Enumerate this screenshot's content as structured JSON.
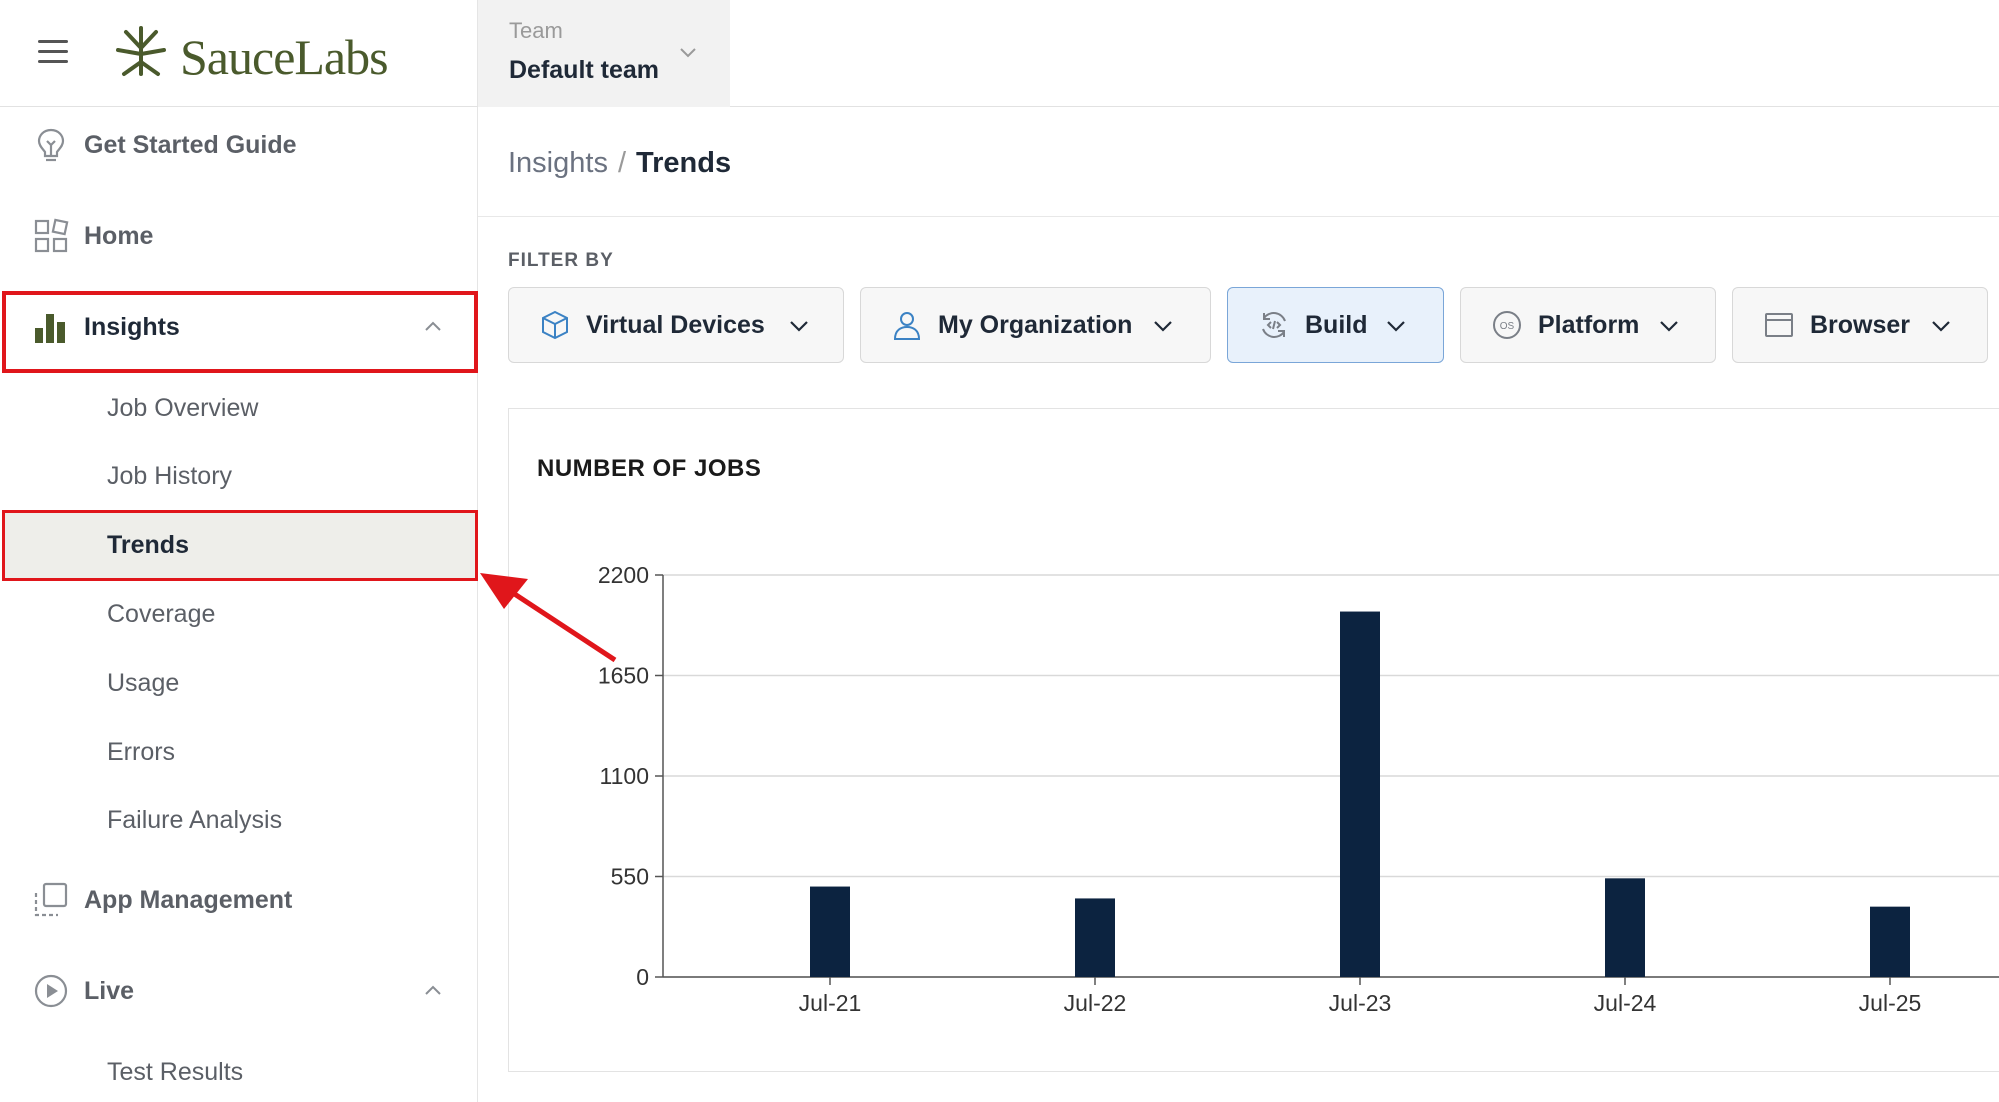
{
  "brand": {
    "name": "SauceLabs"
  },
  "team": {
    "label": "Team",
    "value": "Default team"
  },
  "sidebar": {
    "items": [
      {
        "label": "Get Started Guide",
        "icon": "lightbulb-icon"
      },
      {
        "label": "Home",
        "icon": "grid-icon"
      },
      {
        "label": "Insights",
        "icon": "bar-chart-icon",
        "expanded": true
      },
      {
        "label": "App Management",
        "icon": "app-icon"
      },
      {
        "label": "Live",
        "icon": "play-icon",
        "expanded": true
      }
    ],
    "insights_sub": [
      "Job Overview",
      "Job History",
      "Trends",
      "Coverage",
      "Usage",
      "Errors",
      "Failure Analysis"
    ],
    "live_sub": [
      "Test Results"
    ]
  },
  "breadcrumb": {
    "parent": "Insights",
    "separator": "/",
    "current": "Trends"
  },
  "filter": {
    "label": "FILTER BY",
    "buttons": [
      {
        "label": "Virtual Devices",
        "icon": "cube-icon"
      },
      {
        "label": "My Organization",
        "icon": "user-icon"
      },
      {
        "label": "Build",
        "icon": "build-icon",
        "active": true
      },
      {
        "label": "Platform",
        "icon": "os-icon"
      },
      {
        "label": "Browser",
        "icon": "browser-window-icon"
      }
    ]
  },
  "colors": {
    "accent_red": "#e0161b",
    "bar": "#0c2340",
    "brand_green": "#4a5a2c",
    "active_filter_bg": "#e8f1fb"
  },
  "chart_data": {
    "type": "bar",
    "title": "NUMBER OF JOBS",
    "categories": [
      "Jul-21",
      "Jul-22",
      "Jul-23",
      "Jul-24",
      "Jul-25"
    ],
    "values": [
      495,
      430,
      2000,
      540,
      385
    ],
    "ylim": [
      0,
      2200
    ],
    "yticks": [
      0,
      550,
      1100,
      1650,
      2200
    ],
    "grid": true,
    "xlabel": "",
    "ylabel": ""
  }
}
